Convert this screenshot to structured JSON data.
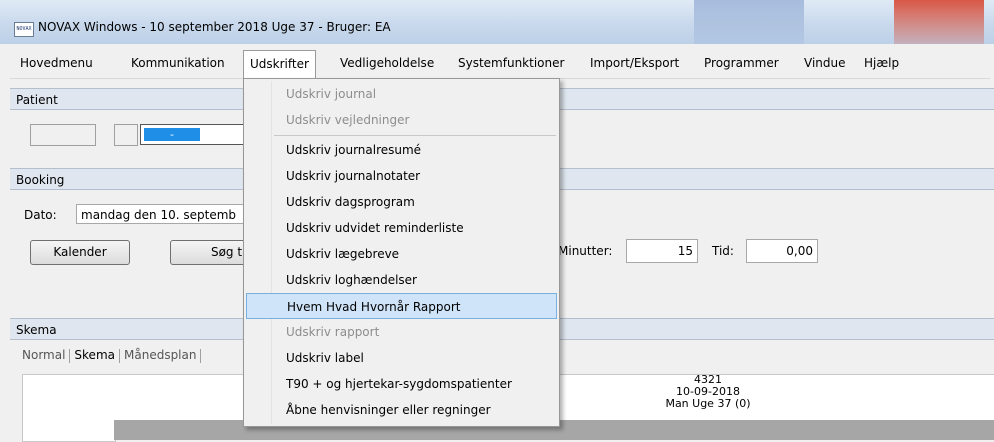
{
  "window": {
    "title": "NOVAX Windows - 10 september 2018 Uge 37 - Bruger: EA",
    "icon": "novax-app-icon",
    "icon_text": "NOVAX"
  },
  "menubar": {
    "items": [
      "Hovedmenu",
      "Kommunikation",
      "Udskrifter",
      "Vedligeholdelse",
      "Systemfunktioner",
      "Import/Eksport",
      "Programmer",
      "Vindue",
      "Hjælp"
    ],
    "active": "Udskrifter"
  },
  "patient": {
    "section_title": "Patient",
    "selector_value": "-"
  },
  "booking": {
    "section_title": "Booking",
    "date_label": "Dato:",
    "date_value": "mandag den 10. septemb",
    "calendar_button": "Kalender",
    "search_button": "Søg tid",
    "minutes_label": "Minutter:",
    "minutes_value": "15",
    "time_label": "Tid:",
    "time_value": "0,00"
  },
  "schedule": {
    "section_title": "Skema",
    "tabs": [
      "Normal",
      "Skema",
      "Månedsplan"
    ],
    "selected_tab": "Skema",
    "column_header": {
      "line1": "4321",
      "line2": "10-09-2018",
      "line3": "Man Uge 37 (0)"
    }
  },
  "udskrifter_menu": {
    "items": [
      {
        "label": "Udskriv journal",
        "enabled": false
      },
      {
        "label": "Udskriv vejledninger",
        "enabled": false
      },
      {
        "label": "Udskriv journalresumé",
        "enabled": true
      },
      {
        "label": "Udskriv journalnotater",
        "enabled": true
      },
      {
        "label": "Udskriv dagsprogram",
        "enabled": true
      },
      {
        "label": "Udskriv udvidet reminderliste",
        "enabled": true
      },
      {
        "label": "Udskriv lægebreve",
        "enabled": true
      },
      {
        "label": "Udskriv loghændelser",
        "enabled": true
      },
      {
        "label": "Hvem Hvad Hvornår Rapport",
        "enabled": true,
        "highlighted": true
      },
      {
        "label": "Udskriv rapport",
        "enabled": false
      },
      {
        "label": "Udskriv label",
        "enabled": true
      },
      {
        "label": "T90 + og hjertekar-sygdomspatienter",
        "enabled": true
      },
      {
        "label": "Åbne henvisninger eller regninger",
        "enabled": true
      }
    ]
  },
  "colors": {
    "section_header": "#dfe6ef",
    "selector_blue": "#1e8ee6",
    "highlight": "#cfe4f8",
    "highlight_border": "#7ab0e0",
    "titlebar_red": "#d4452d"
  }
}
